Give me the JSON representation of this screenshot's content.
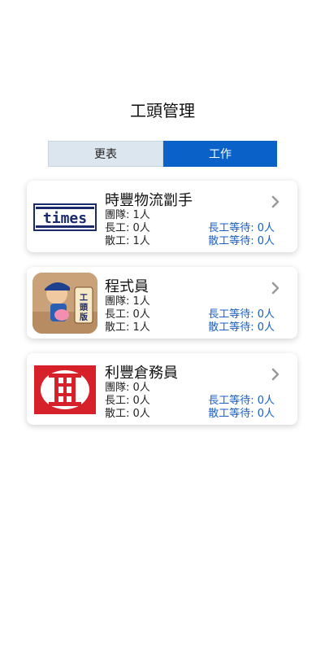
{
  "header": {
    "title": "工頭管理"
  },
  "tabs": [
    {
      "label": "更表",
      "active": false
    },
    {
      "label": "工作",
      "active": true
    }
  ],
  "colors": {
    "accent": "#0a62c9",
    "wait_text": "#1a5fc4",
    "inactive_tab": "#dce6ee"
  },
  "companies": [
    {
      "name": "時豐物流劏手",
      "team": "團隊: 1人",
      "long_work": "長工: 0人",
      "casual_work": "散工: 1人",
      "long_wait": "長工等待: 0人",
      "casual_wait": "散工等待: 0人",
      "logo_text": "times",
      "logo_icon": "times-logo"
    },
    {
      "name": "程式員",
      "team": "團隊: 1人",
      "long_work": "長工: 0人",
      "casual_work": "散工: 1人",
      "long_wait": "長工等待: 0人",
      "casual_wait": "散工等待: 0人",
      "logo_text": "工頭版",
      "logo_icon": "worker-app-logo"
    },
    {
      "name": "利豐倉務員",
      "team": "團隊: 0人",
      "long_work": "長工: 0人",
      "casual_work": "散工: 0人",
      "long_wait": "長工等待: 0人",
      "casual_wait": "散工等待: 0人",
      "logo_text": "",
      "logo_icon": "li-fung-logo"
    }
  ]
}
